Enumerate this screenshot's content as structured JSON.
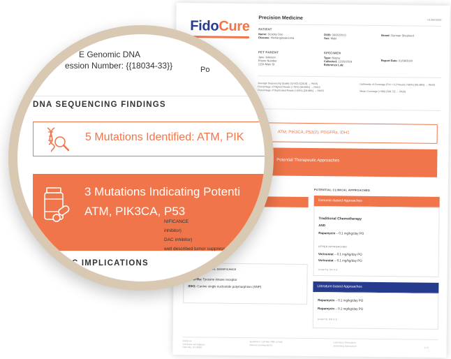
{
  "colors": {
    "brand_blue": "#273c8f",
    "accent_orange": "#f0754a",
    "lens_rim": "#d9c9b3"
  },
  "report": {
    "logo": {
      "part1": "Fido",
      "part2": "Cure"
    },
    "title": "Precision Medicine",
    "date": "01/09/2020",
    "patient": {
      "section": "PATIENT",
      "name_label": "Name:",
      "name": "Scooby Doo",
      "disease_label": "Disease:",
      "disease": "Hemangiosarcoma",
      "dob_label": "DOB:",
      "dob": "06/20/2013",
      "sex_label": "Sex:",
      "sex": "Male",
      "breed_label": "Breed:",
      "breed": "German Shepherd"
    },
    "pet_parent": {
      "section": "PET PARENT",
      "name": "Jane Johnson",
      "phone": "Phone Number",
      "address": "1234 Main St."
    },
    "specimen": {
      "section": "SPECIMEN",
      "type_label": "Type:",
      "type": "Biopsy",
      "collected_label": "Collected:",
      "collected": "12/20/2019",
      "reflab_label": "Reference Lab:",
      "report_date_label": "Report Date:",
      "report_date": "01/09/2020"
    },
    "qc": {
      "left": [
        "Average Sequencing Quality (Q-SO) [Q30.8]  →  PASS",
        "Percentage of Aligned Reads (>75%) [99.89%]  →  PASS",
        "Percentage of Duplicated Reads (<40%) [28.98%]  →  PASS"
      ],
      "right": [
        "Uniformity of Coverage (Pct > 0.2*mean) (>80%) [99.48%]  →  PASS",
        "Mean Coverage (>100) [394.72]  →  PASS"
      ]
    },
    "mutations_line": "ATM, PIK3CA, P53(2), PDGFRa, IDH1",
    "therapeutic_line": "Potential Therapeutic Approaches",
    "unknown": {
      "title": "UNKNOWN CLINICAL SIGNIFICANCE",
      "line1_gene": "PDGFRa:",
      "line1": "Tyrosine kinase receptor",
      "line2_gene": "IDH1:",
      "line2": "Canine single nucleotide polymorphism (SNP)"
    },
    "approaches": {
      "title": "POTENTIAL CLINICAL APPROACHES",
      "genomic_header": "Genomic-based Approaches",
      "traditional": "Traditional Chemotherapy",
      "and": "AND",
      "rapamycin_name": "Rapamycin",
      "rapamycin_dose": "– 0.1 mg/kg/day PO",
      "other": "OTHER APPROACHES",
      "vorinostat_name": "Verinostat",
      "vorinostat_dose": "– 0.1 mg/kg/day PO",
      "link1": "CHAPTE ON P.3",
      "literature_header": "Literature-based Approaches",
      "link2": "CHAPTE ON P.3"
    },
    "footer": {
      "col1": [
        "FidoCure",
        "123 Some Rd Address",
        "Palo Alto, CA 94301"
      ],
      "col2": [
        "Questions? 123 456 7890 or help",
        "fidocure.com/questions"
      ],
      "col3": [
        "Laboratory Information",
        "Something Somewhere"
      ],
      "page": "1 / 6"
    }
  },
  "lens": {
    "gdna": "E Genomic DNA",
    "accession": "ession Number: {{18034-33}}",
    "side_label": "Po",
    "section_title": "DNA SEQUENCING FINDINGS",
    "mutations_text": "5 Mutations Identified: ATM, PIK",
    "therapeutic_line1": "3 Mutations Indicating Potenti",
    "therapeutic_line2": "ATM, PIK3CA, P53",
    "rows": [
      "NIFICANCE",
      "inhibitor)",
      "DAC inhibitor)",
      "well described tumor suppressor"
    ],
    "implications": "C IMPLICATIONS"
  }
}
